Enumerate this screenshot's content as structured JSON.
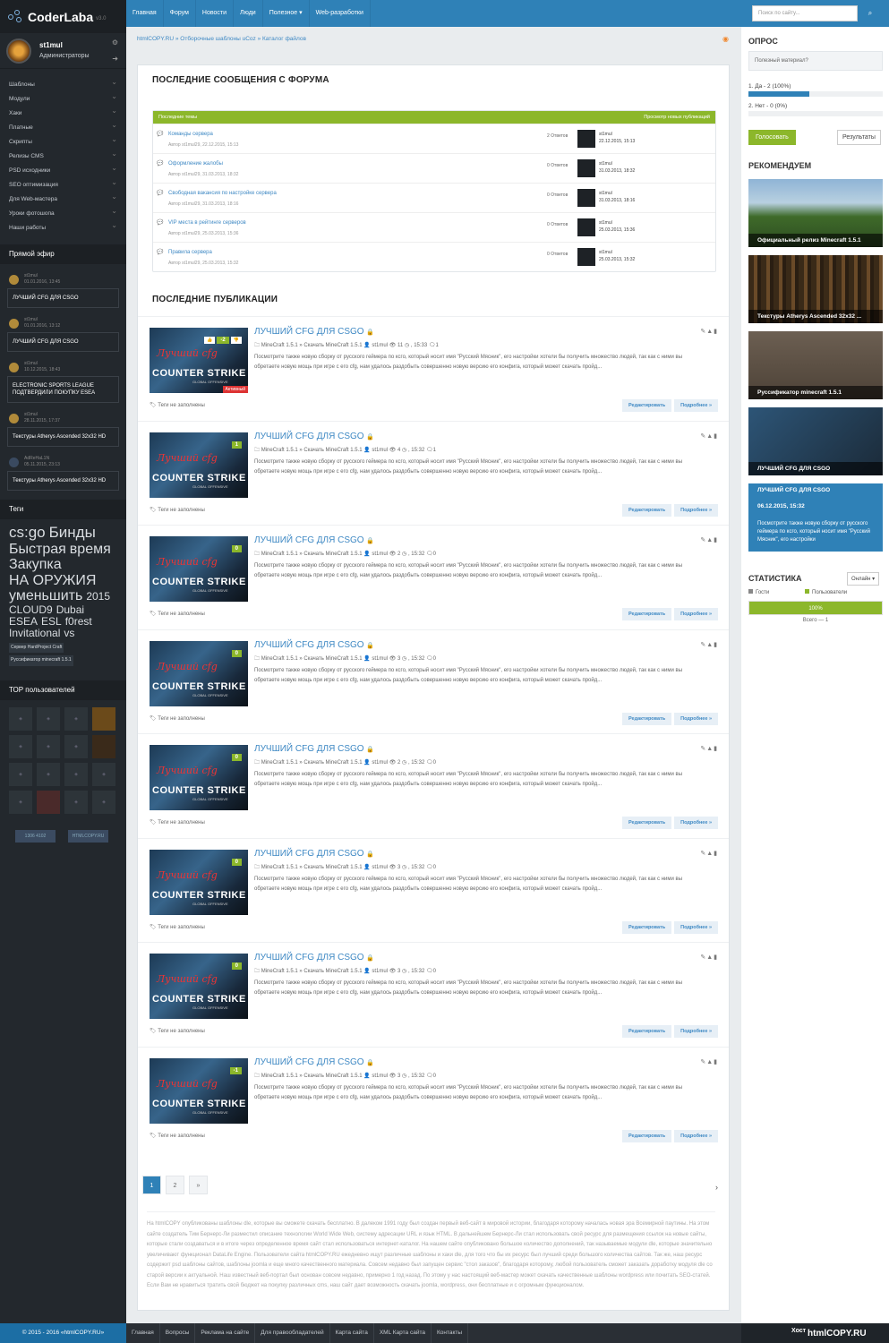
{
  "logo": {
    "name": "CoderLaba",
    "version": "v3.0"
  },
  "user": {
    "name": "st1mul",
    "role": "Администраторы"
  },
  "sidebar_menu": [
    "Шаблоны",
    "Модули",
    "Хаки",
    "Платные",
    "Скрипты",
    "Релизы CMS",
    "PSD исходники",
    "SEO оптимизация",
    "Для Web-мастера",
    "Уроки фотошопа",
    "Наши работы"
  ],
  "live_title": "Прямой эфир",
  "live": [
    {
      "user": "st1mul",
      "date": "01.01.2016, 13:45",
      "text": "ЛУЧШИЙ CFG ДЛЯ CSGO"
    },
    {
      "user": "st1mul",
      "date": "01.01.2016, 13:12",
      "text": "ЛУЧШИЙ CFG ДЛЯ CSGO"
    },
    {
      "user": "st1mul",
      "date": "10.12.2015, 18:43",
      "text": "ELECTRONIC SPORTS LEAGUE ПОДТВЕРДИЛИ ПОКУПКУ ESEA"
    },
    {
      "user": "st1mul",
      "date": "28.11.2015, 17:37",
      "text": "Текстуры Atherys Ascended 32x32 HD"
    },
    {
      "user": "AdReНaL1N",
      "date": "05.11.2015, 23:13",
      "text": "Текстуры Atherys Ascended 32x32 HD"
    }
  ],
  "tags_title": "Теги",
  "tags": [
    {
      "t": "cs:go",
      "s": 17
    },
    {
      "t": "Бинды",
      "s": 17
    },
    {
      "t": "Быстрая",
      "s": 16
    },
    {
      "t": "время",
      "s": 16
    },
    {
      "t": "Закупка",
      "s": 16
    },
    {
      "t": "НА ОРУЖИЯ",
      "s": 16
    },
    {
      "t": "уменьшить",
      "s": 16
    },
    {
      "t": "2015",
      "s": 12
    },
    {
      "t": "CLOUD9",
      "s": 12
    },
    {
      "t": "Dubai",
      "s": 12
    },
    {
      "t": "ESEA",
      "s": 12
    },
    {
      "t": "ESL",
      "s": 12
    },
    {
      "t": "f0rest",
      "s": 12
    },
    {
      "t": "Invitational",
      "s": 12
    },
    {
      "t": "vs",
      "s": 12
    },
    {
      "t": "Сервер HardProject Craft",
      "s": 5
    },
    {
      "t": "Руссификатор minecraft 1.5.1",
      "s": 5
    }
  ],
  "topusers_title": "ТОР пользователей",
  "counters": [
    "1306 4102",
    "HTMLCOPY.RU"
  ],
  "footer_left": "© 2015 - 2016 «htmlCOPY.RU»",
  "nav": [
    "Главная",
    "Форум",
    "Новости",
    "Люди",
    "Полезное ▾",
    "Web-разработки"
  ],
  "breadcrumb": "htmlCOPY.RU » Отборочные шаблоны uCoz » Каталог файлов",
  "forum": {
    "title": "ПОСЛЕДНИЕ СООБЩЕНИЯ С ФОРУМА",
    "head_left": "Последние темы",
    "head_right": "Просмотр новых публикаций",
    "rows": [
      {
        "t": "Команды сервера",
        "m": "Автор st1mul29, 22.12.2015, 15:13",
        "c": "2 Ответов",
        "u": "st1mul",
        "d": "22.12.2015, 15:13"
      },
      {
        "t": "Оформление жалобы",
        "m": "Автор st1mul29, 31.03.2013, 18:32",
        "c": "0 Ответов",
        "u": "st1mul",
        "d": "31.03.2013, 18:32"
      },
      {
        "t": "Свободная вакансия по настройке сервера",
        "m": "Автор st1mul29, 31.03.2013, 18:16",
        "c": "0 Ответов",
        "u": "st1mul",
        "d": "31.03.2013, 18:16"
      },
      {
        "t": "VIP места в рейтинге серверов",
        "m": "Автор st1mul29, 25.03.2013, 15:36",
        "c": "0 Ответов",
        "u": "st1mul",
        "d": "25.03.2013, 15:36"
      },
      {
        "t": "Правила сервера",
        "m": "Автор st1mul29, 25.03.2013, 15:32",
        "c": "0 Ответов",
        "u": "st1mul",
        "d": "25.03.2013, 15:32"
      }
    ]
  },
  "pubs_title": "ПОСЛЕДНИЕ ПУБЛИКАЦИИ",
  "post_common": {
    "title": "ЛУЧШИЙ CFG ДЛЯ CSGO",
    "cat": "MineCraft 1.5.1 » Скачать MineCraft 1.5.1",
    "author": "st1mul",
    "desc": "Посмотрите также новую сборку от русского геймера по ксго, который носит имя \"Русский Мясник\", его настройки хотели бы получить множество людей, так как с ними вы обретаете новую мощь при игре с его cfg, нам удалось раздобыть совершенно новую версию его конфига, который может скачать пройд...",
    "tags": "Теги не заполнены",
    "edit": "Редактировать",
    "more": "Подробнее »",
    "active": "Активный"
  },
  "posts": [
    {
      "rating": "-2",
      "views": "11",
      "time": ", 15:33",
      "comments": "1"
    },
    {
      "rating": "1",
      "views": "4",
      "time": ", 15:32",
      "comments": "1"
    },
    {
      "rating": "0",
      "views": "2",
      "time": ", 15:32",
      "comments": "0"
    },
    {
      "rating": "0",
      "views": "3",
      "time": ", 15:32",
      "comments": "0"
    },
    {
      "rating": "0",
      "views": "2",
      "time": ", 15:32",
      "comments": "0"
    },
    {
      "rating": "0",
      "views": "3",
      "time": ", 15:32",
      "comments": "0"
    },
    {
      "rating": "0",
      "views": "3",
      "time": ", 15:32",
      "comments": "0"
    },
    {
      "rating": "-1",
      "views": "3",
      "time": ", 15:32",
      "comments": "0"
    }
  ],
  "pager": [
    "1",
    "2",
    "»"
  ],
  "seo_text": "На htmlCOPY опубликованы шаблоны dle, которые вы сможете скачать бесплатно. В далеком 1991 году был создан первый веб-сайт в мировой истории, благодаря которому началась новая эра Всемирной паутины. На этом сайте создатель Тим Бернерс-Ли разместил описание технологии World Wide Web, систему адресации URL и язык HTML. В дальнейшем Бернерс-Ли стал использовать свой ресурс для размещения ссылок на новые сайты, которые стали создаваться и в итоге через определенное время сайт стал использоваться интернет-каталог. На нашем сайте опубликовано большое количество дополнений, так называемые модули dle, которые значительно увеличивают функционал DataLife Engine. Пользователи сайта htmlCOPY.RU ежедневно ищут различные шаблоны и хаки dle, для того что бы их ресурс был лучший среди большого количества сайтов. Так же, наш ресурс содержит psd шаблоны сайтов, шаблоны joomla и еще много качественного материала. Совсем недавно был запущен сервис \"стол заказов\", благодаря которому, любой пользователь сможет заказать доработку модуля dle со старой версии к актуальной. Наш известный веб-портал был основан совсем недавно, примерно 1 год назад. По этому у нас настоящий веб-мастер может скачать качественные шаблоны wordpress или почитать SEO-статей. Если Вам не нравиться тратить свой бюджет на покупку различных cms, наш сайт дает возможность скачать joomla, wordpress, они бесплатные и с огромным функционалом.",
  "footer_links": [
    "Главная",
    "Вопросы",
    "Реклама на сайте",
    "Для правообладателей",
    "Карта сайта",
    "XML Карта сайта",
    "Контакты"
  ],
  "search_placeholder": "Поиск по сайту...",
  "poll": {
    "title": "ОПРОС",
    "question": "Полезный материал?",
    "a1": "1. Да - 2 (100%)",
    "a1_frac": 1.0,
    "a2": "2. Нет - 0 (0%)",
    "a2_frac": 0.0,
    "vote": "Голосовать",
    "results": "Результаты"
  },
  "recommend": {
    "title": "РЕКОМЕНДУЕМ",
    "items": [
      "Официальный релиз Minecraft 1.5.1",
      "Текстуры Atherys Ascended 32x32 ...",
      "Руссификатор minecraft 1.5.1",
      "ЛУЧШИЙ CFG ДЛЯ CSGO"
    ],
    "last": {
      "title": "ЛУЧШИЙ CFG ДЛЯ CSGO",
      "date": "06.12.2015, 15:32",
      "text": "Посмотрите также новую сборку от русского геймера по ксго, который носит имя \"Русский Мясник\", его настройки"
    }
  },
  "stats": {
    "title": "СТАТИСТИКА",
    "dropdown": "Онлайн ▾",
    "guests": "Гости",
    "users": "Пользователи",
    "bar": "100%",
    "total": "Всего — 1"
  },
  "right_footer": "Хост",
  "watermark": "htmlCOPY.RU"
}
